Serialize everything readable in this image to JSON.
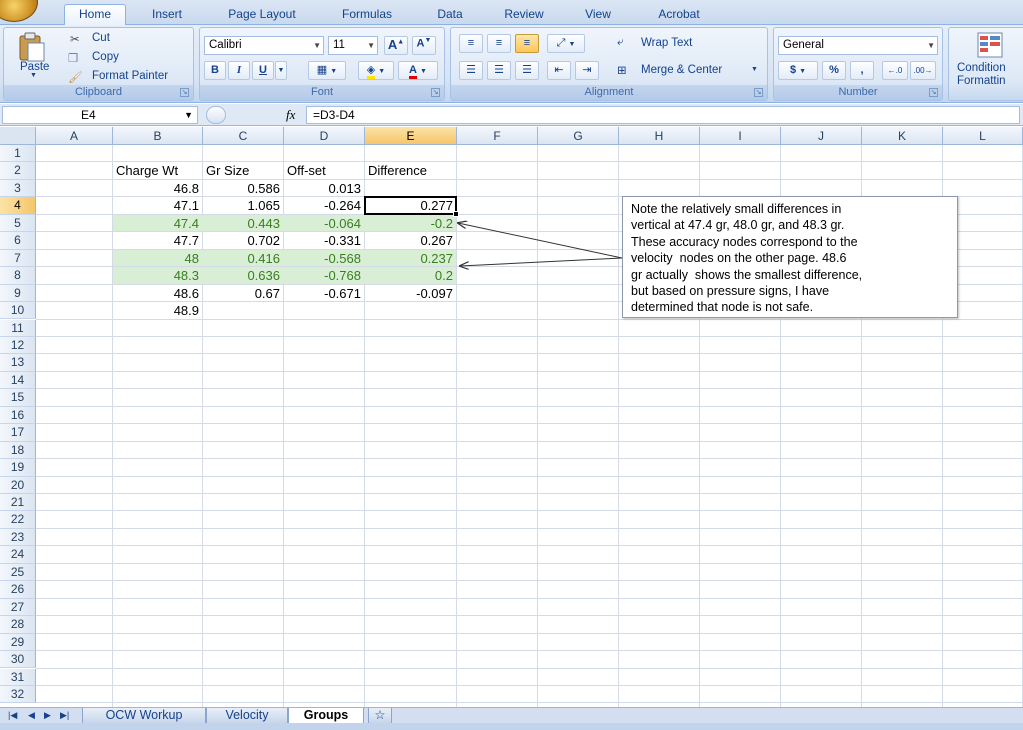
{
  "ribbon": {
    "tabs": [
      "Home",
      "Insert",
      "Page Layout",
      "Formulas",
      "Data",
      "Review",
      "View",
      "Acrobat"
    ],
    "active_tab": "Home",
    "clipboard": {
      "label": "Clipboard",
      "paste": "Paste",
      "cut": "Cut",
      "copy": "Copy",
      "format_painter": "Format Painter"
    },
    "font": {
      "label": "Font",
      "name": "Calibri",
      "size": "11",
      "bold": "B",
      "italic": "I",
      "underline": "U",
      "font_color_glyph": "A"
    },
    "alignment": {
      "label": "Alignment",
      "wrap_text": "Wrap Text",
      "merge_center": "Merge & Center"
    },
    "number": {
      "label": "Number",
      "format": "General",
      "currency": "$",
      "percent": "%",
      "comma": ","
    },
    "styles": {
      "conditional_line1": "Condition",
      "conditional_line2": "Formattin"
    }
  },
  "formula_bar": {
    "name_box": "E4",
    "fx": "fx",
    "formula": "=D3-D4"
  },
  "sheet": {
    "columns": [
      "A",
      "B",
      "C",
      "D",
      "E",
      "F",
      "G",
      "H",
      "I",
      "J",
      "K",
      "L"
    ],
    "rows": [
      "1",
      "2",
      "3",
      "4",
      "5",
      "6",
      "7",
      "8",
      "9",
      "10",
      "11",
      "12",
      "13",
      "14",
      "15",
      "16",
      "17",
      "18",
      "19",
      "20",
      "21",
      "22",
      "23",
      "24",
      "25",
      "26",
      "27",
      "28",
      "29",
      "30",
      "31",
      "32"
    ],
    "selected_column": "E",
    "selected_row": "4",
    "headers": {
      "b": "Charge Wt",
      "c": "Gr Size",
      "d": "Off-set",
      "e": "Difference"
    },
    "data": [
      {
        "b": "46.8",
        "c": "0.586",
        "d": "0.013",
        "e": "",
        "hl": false
      },
      {
        "b": "47.1",
        "c": "1.065",
        "d": "-0.264",
        "e": "0.277",
        "hl": false
      },
      {
        "b": "47.4",
        "c": "0.443",
        "d": "-0.064",
        "e": "-0.2",
        "hl": true
      },
      {
        "b": "47.7",
        "c": "0.702",
        "d": "-0.331",
        "e": "0.267",
        "hl": false
      },
      {
        "b": "48",
        "c": "0.416",
        "d": "-0.568",
        "e": "0.237",
        "hl": true
      },
      {
        "b": "48.3",
        "c": "0.636",
        "d": "-0.768",
        "e": "0.2",
        "hl": true
      },
      {
        "b": "48.6",
        "c": "0.67",
        "d": "-0.671",
        "e": "-0.097",
        "hl": false
      },
      {
        "b": "48.9",
        "c": "",
        "d": "",
        "e": "",
        "hl": false
      }
    ],
    "highlight_color": "#d8efd6",
    "highlight_text_color": "#3a7d1e"
  },
  "note": {
    "lines": [
      "Note the relatively small differences in",
      "vertical at 47.4 gr, 48.0 gr, and 48.3 gr.",
      "These accuracy nodes correspond to the",
      "velocity  nodes on the other page. 48.6",
      "gr actually  shows the smallest difference,",
      "but based on pressure signs, I have",
      "determined that node is not safe."
    ]
  },
  "sheet_tabs": {
    "tabs": [
      "OCW Workup",
      "Velocity",
      "Groups"
    ],
    "active": "Groups"
  }
}
